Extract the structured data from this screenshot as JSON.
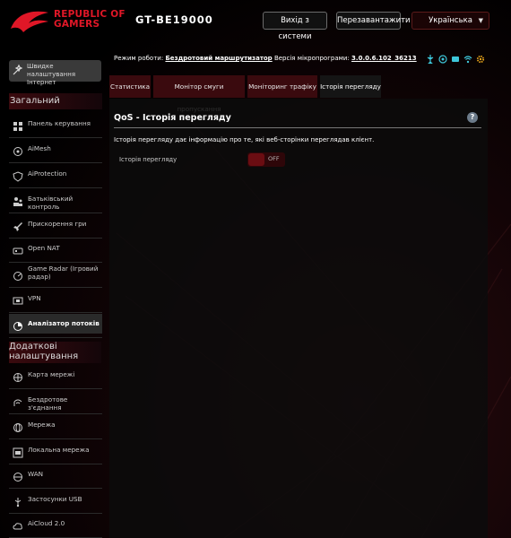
{
  "header": {
    "brand_line1": "REPUBLIC OF",
    "brand_line2": "GAMERS",
    "model": "GT-BE19000",
    "logout_label": "Вихід з системи",
    "reboot_label": "Перезавантажити",
    "language_label": "Українська"
  },
  "status": {
    "mode_label": "Режим роботи:",
    "mode_value": "Бездротовий маршрутизатор",
    "fw_label": "Версія мікропрограми:",
    "fw_value": "3.0.0.6.102_36213",
    "icons": [
      "usb-icon",
      "network-icon",
      "device-icon",
      "wifi-icon",
      "settings-icon"
    ]
  },
  "sidebar": {
    "quick_setup": "Швидке налаштування Інтернет",
    "general_title": "Загальний",
    "general_items": [
      {
        "label": "Панель керування",
        "icon": "dashboard-icon"
      },
      {
        "label": "AiMesh",
        "icon": "aimesh-icon"
      },
      {
        "label": "AiProtection",
        "icon": "shield-icon"
      },
      {
        "label": "Батьківський контроль",
        "icon": "parental-icon"
      },
      {
        "label": "Прискорення гри",
        "icon": "rocket-icon"
      },
      {
        "label": "Open NAT",
        "icon": "nat-icon"
      },
      {
        "label": "Game Radar (Ігровий радар)",
        "icon": "radar-icon"
      },
      {
        "label": "VPN",
        "icon": "vpn-icon"
      },
      {
        "label": "Аналізатор потоків",
        "icon": "analyzer-icon"
      }
    ],
    "advanced_title": "Додаткові налаштування",
    "advanced_items": [
      {
        "label": "Карта мережі",
        "icon": "map-icon"
      },
      {
        "label": "Бездротове з'єднання",
        "icon": "wireless-icon"
      },
      {
        "label": "Мережа",
        "icon": "network-icon"
      },
      {
        "label": "Локальна мережа",
        "icon": "lan-icon"
      },
      {
        "label": "WAN",
        "icon": "wan-icon"
      },
      {
        "label": "Застосунки USB",
        "icon": "usb-icon"
      },
      {
        "label": "AiCloud 2.0",
        "icon": "cloud-icon"
      }
    ]
  },
  "tabs": [
    {
      "label": "Статистика"
    },
    {
      "label": "Монітор смуги пропускання"
    },
    {
      "label": "Моніторинг трафіку"
    },
    {
      "label": "Історія перегляду"
    }
  ],
  "panel": {
    "title": "QoS - Історія перегляду",
    "description": "Історія перегляду дає інформацію про те, які веб-сторінки переглядав клієнт.",
    "setting_label": "Історія перегляду",
    "toggle_state": "OFF"
  },
  "colors": {
    "accent": "#e01727",
    "tab_bg": "#3a0a0e",
    "sidebar_header": "#3a0a0e"
  }
}
